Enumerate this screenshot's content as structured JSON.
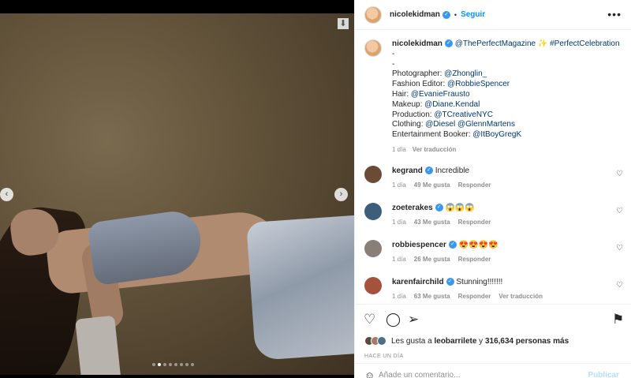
{
  "post": {
    "username": "nicolekidman",
    "follow_label": "Seguir",
    "sep": "•",
    "more_icon": "more-icon"
  },
  "caption": {
    "username": "nicolekidman",
    "mention": "@ThePerfectMagazine",
    "sparkle": "✨",
    "hashtag": "#PerfectCelebration",
    "dash1": "-",
    "dash2": "-",
    "credits": [
      {
        "label": "Photographer: ",
        "handle": "@Zhonglin_"
      },
      {
        "label": "Fashion Editor: ",
        "handle": "@RobbieSpencer"
      },
      {
        "label": "Hair: ",
        "handle": "@EvanieFrausto"
      },
      {
        "label": "Makeup: ",
        "handle": "@Diane.Kendal"
      },
      {
        "label": "Production: ",
        "handle": "@TCreativeNYC"
      },
      {
        "label": "Clothing: ",
        "handle": "@Diesel",
        "handle2": "@GlennMartens"
      },
      {
        "label": "Entertainment Booker: ",
        "handle": "@ItBoyGregK"
      }
    ],
    "time": "1 día",
    "translate": "Ver traducción"
  },
  "comments": [
    {
      "user": "kegrand",
      "text": "Incredible",
      "time": "1 día",
      "likes": "49 Me gusta",
      "reply": "Responder",
      "translate": "",
      "avatar_color": "#6b4a36"
    },
    {
      "user": "zoeterakes",
      "text": "😱😱😱",
      "time": "1 día",
      "likes": "43 Me gusta",
      "reply": "Responder",
      "translate": "",
      "avatar_color": "#3e5d7a"
    },
    {
      "user": "robbiespencer",
      "text": "😍😍😍😍",
      "time": "1 día",
      "likes": "26 Me gusta",
      "reply": "Responder",
      "translate": "",
      "avatar_color": "#8a7f76"
    },
    {
      "user": "karenfairchild",
      "text": "Stunning!!!!!!!",
      "time": "1 día",
      "likes": "63 Me gusta",
      "reply": "Responder",
      "translate": "Ver traducción",
      "avatar_color": "#a5523c"
    }
  ],
  "likes": {
    "prefix": "Les gusta a ",
    "user": "leobarrilete",
    "middle": " y ",
    "count": "316,634 personas más"
  },
  "time_ago": "HACE UN DÍA",
  "comment_box": {
    "placeholder": "Añade un comentario...",
    "publish": "Publicar"
  },
  "carousel": {
    "count": 8,
    "active_index": 1
  },
  "colors": {
    "accent": "#0095f6",
    "verified": "#3897f0",
    "link": "#00376b"
  }
}
